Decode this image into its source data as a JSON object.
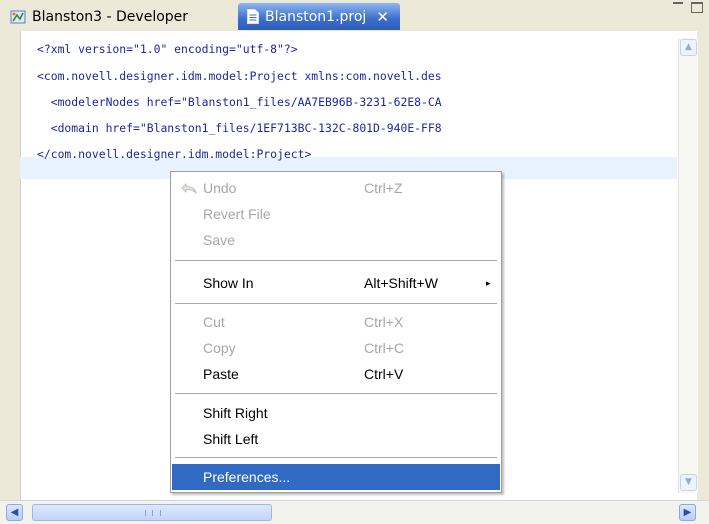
{
  "tabs": [
    {
      "label": "Blanston3 - Developer",
      "active": false,
      "icon": "perspective-icon"
    },
    {
      "label": "Blanston1.proj",
      "active": true,
      "icon": "file-icon",
      "close": "✕"
    }
  ],
  "editor": {
    "lines": [
      "<?xml version=\"1.0\" encoding=\"utf-8\"?>",
      "<com.novell.designer.idm.model:Project xmlns:com.novell.des",
      "  <modelerNodes href=\"Blanston1_files/AA7EB96B-3231-62E8-CA",
      "  <domain href=\"Blanston1_files/1EF713BC-132C-801D-940E-FF8",
      "</com.novell.designer.idm.model:Project>"
    ]
  },
  "context_menu": {
    "groups": [
      [
        {
          "label": "Undo",
          "shortcut": "Ctrl+Z",
          "enabled": false,
          "icon": "undo-icon"
        },
        {
          "label": "Revert File",
          "shortcut": "",
          "enabled": false
        },
        {
          "label": "Save",
          "shortcut": "",
          "enabled": false
        }
      ],
      [
        {
          "label": "Show In",
          "shortcut": "Alt+Shift+W",
          "enabled": true,
          "submenu": "▸"
        }
      ],
      [
        {
          "label": "Cut",
          "shortcut": "Ctrl+X",
          "enabled": false
        },
        {
          "label": "Copy",
          "shortcut": "Ctrl+C",
          "enabled": false
        },
        {
          "label": "Paste",
          "shortcut": "Ctrl+V",
          "enabled": true
        }
      ],
      [
        {
          "label": "Shift Right",
          "shortcut": "",
          "enabled": true
        },
        {
          "label": "Shift Left",
          "shortcut": "",
          "enabled": true
        }
      ],
      [
        {
          "label": "Preferences...",
          "shortcut": "",
          "enabled": true,
          "selected": true
        }
      ]
    ]
  },
  "colors": {
    "code": "#1a28a0",
    "menu_selected": "#316ac5",
    "current_line": "#e8f2fe"
  }
}
